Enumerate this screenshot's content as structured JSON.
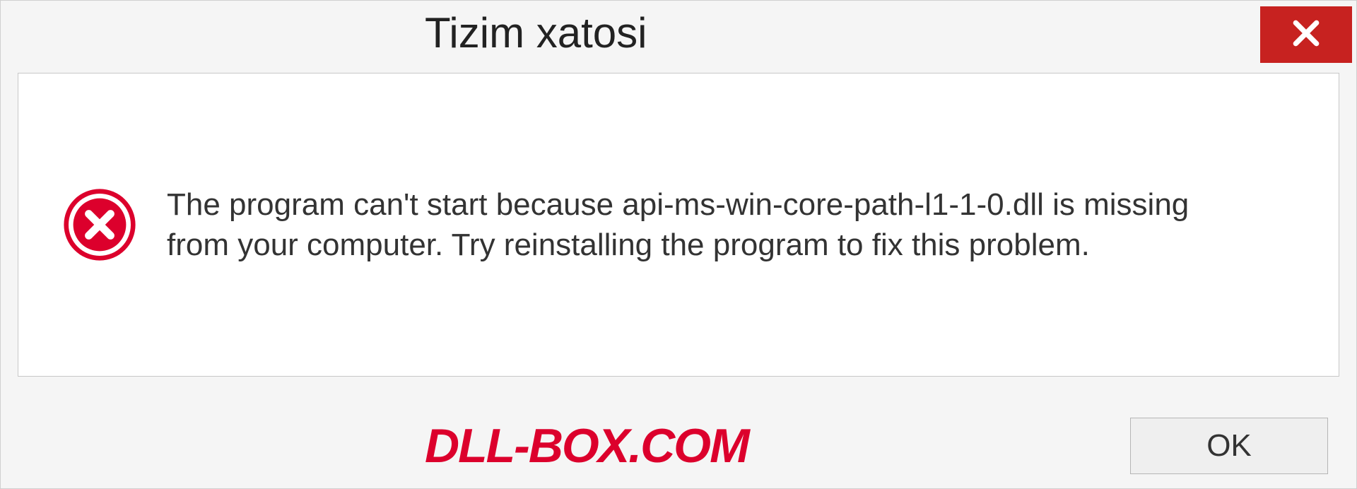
{
  "dialog": {
    "title": "Tizim xatosi",
    "message": "The program can't start because api-ms-win-core-path-l1-1-0.dll is missing from your computer. Try reinstalling the program to fix this problem.",
    "ok_label": "OK"
  },
  "watermark": {
    "text": "DLL-BOX.COM"
  },
  "colors": {
    "close_bg": "#c72220",
    "error_red": "#dc002c"
  }
}
